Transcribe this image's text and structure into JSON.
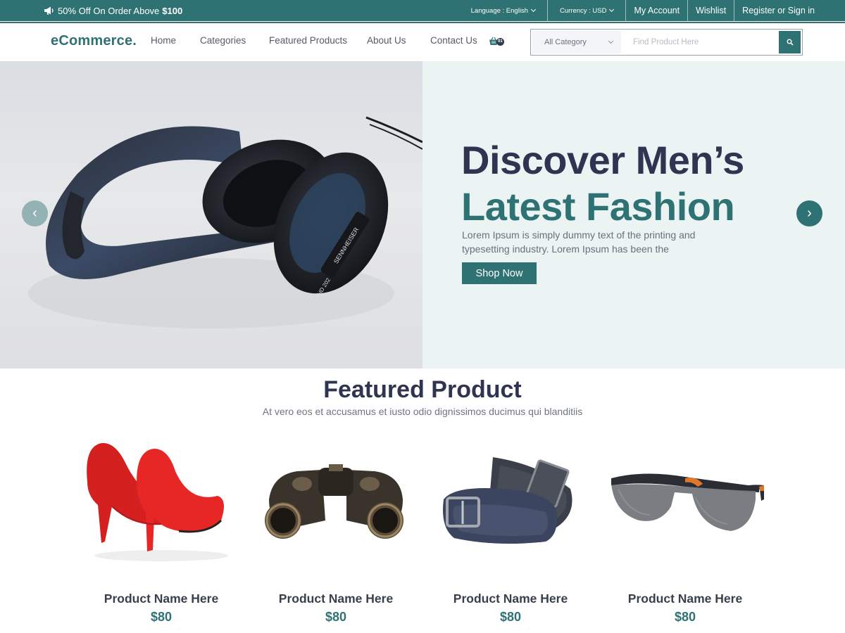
{
  "topbar": {
    "promo_text": "50% Off On Order Above",
    "promo_amount": "$100",
    "language": "Language : English",
    "currency": "Currency : USD",
    "my_account": "My Account",
    "wishlist": "Wishlist",
    "register": "Register or Sign in",
    "icon": "megaphone-icon"
  },
  "header": {
    "logo": "eCommerce.",
    "nav": [
      "Home",
      "Categories",
      "Featured Products",
      "About Us",
      "Contact Us"
    ],
    "cart_count": "01",
    "search": {
      "category": "All Category",
      "placeholder": "Find Product Here"
    }
  },
  "hero": {
    "line1": "Discover Men’s",
    "line2": "Latest Fashion",
    "description": "Lorem Ipsum is simply dummy text of the printing and typesetting industry. Lorem Ipsum has been the",
    "button": "Shop Now",
    "prev_symbol": "‹",
    "next_symbol": "›",
    "headphone_model": "HD 202",
    "headphone_brand": "SENNHEISER"
  },
  "featured": {
    "title": "Featured Product",
    "subtitle": "At vero eos et accusamus et iusto odio dignissimos ducimus qui blanditiis",
    "products": [
      {
        "name": "Product Name Here",
        "price": "$80",
        "image": "red-heels"
      },
      {
        "name": "Product Name Here",
        "price": "$80",
        "image": "binoculars"
      },
      {
        "name": "Product Name Here",
        "price": "$80",
        "image": "belts"
      },
      {
        "name": "Product Name Here",
        "price": "$80",
        "image": "sunglasses"
      }
    ]
  },
  "colors": {
    "accent": "#2f7274",
    "heading": "#2f3550",
    "hero_panel": "#ebf3f3"
  }
}
